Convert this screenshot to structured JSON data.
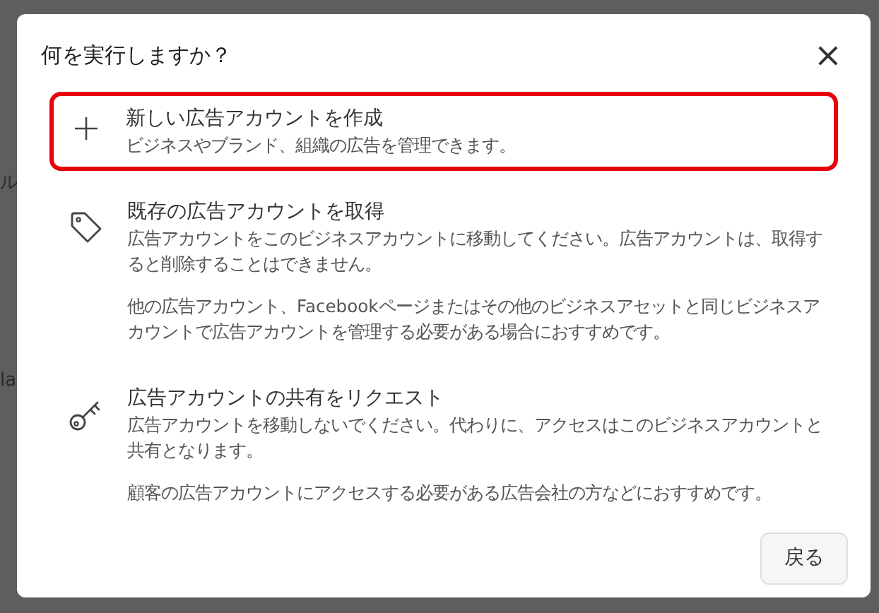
{
  "background": {
    "fragments": [
      "ル",
      "la"
    ]
  },
  "dialog": {
    "title": "何を実行しますか？",
    "close": "×",
    "options": [
      {
        "kind": "plus",
        "selected": true,
        "title": "新しい広告アカウントを作成",
        "paragraphs": [
          "ビジネスやブランド、組織の広告を管理できます。"
        ]
      },
      {
        "kind": "tag",
        "selected": false,
        "title": "既存の広告アカウントを取得",
        "paragraphs": [
          "広告アカウントをこのビジネスアカウントに移動してください。広告アカウントは、取得すると削除することはできません。",
          "他の広告アカウント、Facebookページまたはその他のビジネスアセットと同じビジネスアカウントで広告アカウントを管理する必要がある場合におすすめです。"
        ]
      },
      {
        "kind": "key",
        "selected": false,
        "title": "広告アカウントの共有をリクエスト",
        "paragraphs": [
          "広告アカウントを移動しないでください。代わりに、アクセスはこのビジネスアカウントと共有となります。",
          "顧客の広告アカウントにアクセスする必要がある広告会社の方などにおすすめです。"
        ]
      }
    ],
    "back_button": "戻る"
  }
}
